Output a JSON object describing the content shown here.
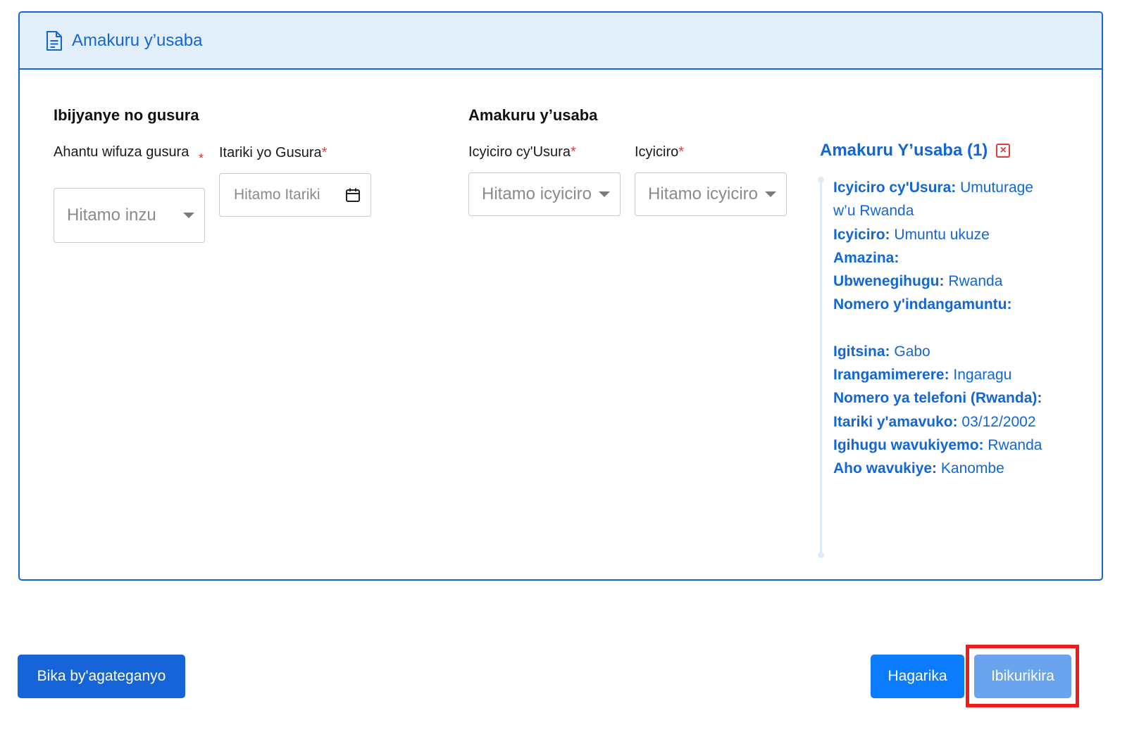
{
  "header": {
    "title": "Amakuru y’usaba"
  },
  "visit_section": {
    "title": "Ibijyanye no gusura",
    "place_label": "Ahantu wifuza gusura",
    "place_required": "*",
    "place_placeholder": "Hitamo inzu",
    "date_label": "Itariki yo Gusura",
    "date_required": "*",
    "date_placeholder": "Hitamo Itariki"
  },
  "applicant_section": {
    "title": "Amakuru y’usaba",
    "visitor_category_label": "Icyiciro cy'Usura",
    "visitor_category_required": "*",
    "visitor_category_placeholder": "Hitamo icyiciro",
    "category_label": "Icyiciro",
    "category_required": "*",
    "category_placeholder": "Hitamo icyiciro"
  },
  "summary": {
    "title": "Amakuru Y’usaba (1)",
    "close_glyph": "×",
    "rows": [
      {
        "key": "Icyiciro cy'Usura:",
        "value": "Umuturage w’u Rwanda"
      },
      {
        "key": "Icyiciro:",
        "value": "Umuntu ukuze"
      },
      {
        "key": "Amazina:",
        "value": ""
      },
      {
        "key": "Ubwenegihugu:",
        "value": "Rwanda"
      },
      {
        "key": "Nomero y'indangamuntu:",
        "value": ""
      },
      {
        "key": "Igitsina:",
        "value": "Gabo"
      },
      {
        "key": "Irangamimerere:",
        "value": "Ingaragu"
      },
      {
        "key": "Nomero ya telefoni (Rwanda):",
        "value": ""
      },
      {
        "key": "Itariki y'amavuko:",
        "value": "03/12/2002"
      },
      {
        "key": "Igihugu wavukiyemo:",
        "value": "Rwanda"
      },
      {
        "key": "Aho wavukiye:",
        "value": "Kanombe"
      }
    ]
  },
  "footer": {
    "draft_label": "Bika by'agateganyo",
    "cancel_label": "Hagarika",
    "submit_label": "Ibikurikira"
  },
  "colors": {
    "accent": "#1565d8",
    "header_bg": "#e3eefb",
    "required": "#e53935",
    "highlight": "#ee1d1d"
  }
}
